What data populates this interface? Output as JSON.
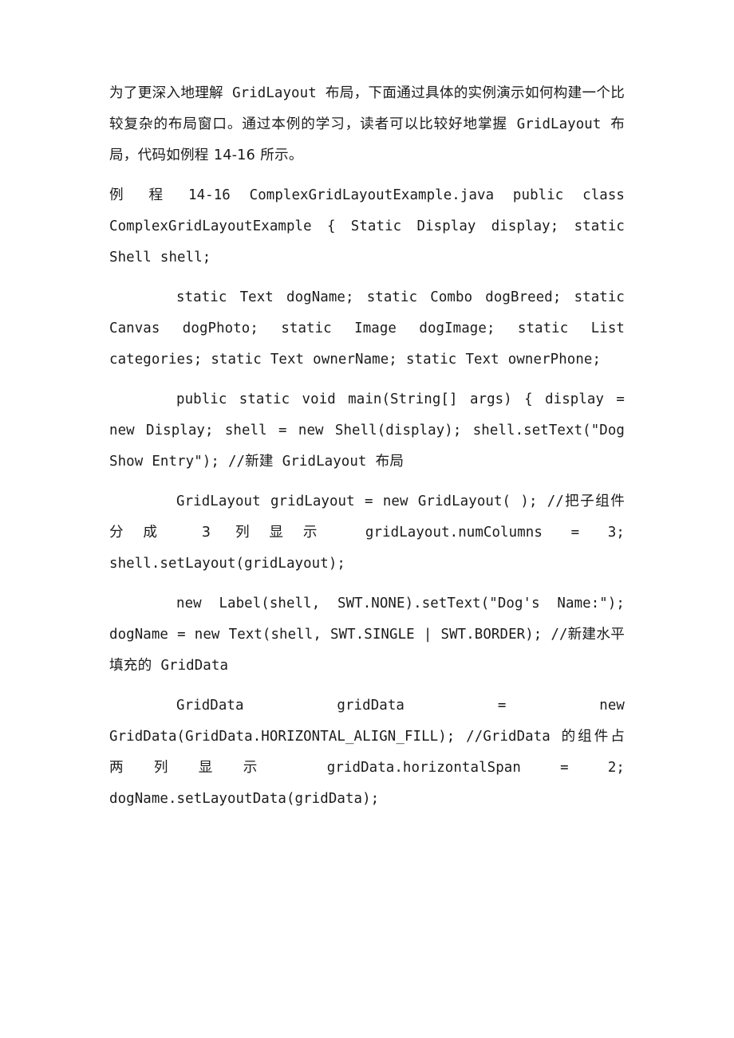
{
  "document": {
    "type": "book-page",
    "language": "zh-CN",
    "page_background": "#ffffff",
    "text_color": "#1b1b1b",
    "body": {
      "intro_paragraph": "为了更深入地理解 GridLayout 布局，下面通过具体的实例演示如何构建一个比较复杂的布局窗口。通过本例的学习，读者可以比较好地掌握 GridLayout 布局，代码如例程 14-16 所示。",
      "listing_heading": "例 程 14-16    ComplexGridLayoutExample.java  public class ComplexGridLayoutExample {            Static Display display;  static Shell shell;",
      "listing_fields": "static Text dogName;          static Combo dogBreed;  static Canvas dogPhoto;          static Image dogImage;  static List categories;          static Text ownerName;  static Text ownerPhone;",
      "listing_main": "public static void main(String[] args) {  display = new Display;          shell = new Shell(display);  shell.setText(\"Dog Show Entry\");            //新建 GridLayout 布局",
      "listing_gridlayout": "GridLayout gridLayout = new GridLayout( );  //把子组件分成 3 列显示          gridLayout.numColumns = 3;  shell.setLayout(gridLayout);",
      "listing_label": "new Label(shell, SWT.NONE).setText(\"Dog's Name:\");  dogName = new Text(shell, SWT.SINGLE | SWT.BORDER);  //新建水平填充的 GridData",
      "listing_griddata": "GridData gridData = new GridData(GridData.HORIZONTAL_ALIGN_FILL);  //GridData 的组件占两列显示          gridData.horizontalSpan = 2;          dogName.setLayoutData(gridData);"
    },
    "fragments": {
      "p1": [
        {
          "t": "cjk",
          "s": "为了更深入地理解"
        },
        {
          "t": "code",
          "s": " GridLayout "
        },
        {
          "t": "cjk",
          "s": "布局，下面通过具体的实例演示如何构建一个比较复杂的布局窗口。通过本例的学习，读者可以比较好地掌握"
        },
        {
          "t": "code",
          "s": " GridLayout "
        },
        {
          "t": "cjk",
          "s": "布局，代码如例程 14-16 所示。"
        }
      ],
      "p2": [
        {
          "t": "cjk",
          "s": "例 程 "
        },
        {
          "t": "code",
          "s": "14-16    ComplexGridLayoutExample.java  public  class  ComplexGridLayoutExample {            Static  Display  display;  static Shell shell;"
        }
      ],
      "p3": [
        {
          "t": "code",
          "s": "static  Text  dogName;          static  Combo  dogBreed;  static  Canvas  dogPhoto;          static  Image  dogImage;  static  List  categories;          static  Text  ownerName;  static Text ownerPhone;"
        }
      ],
      "p4": [
        {
          "t": "code",
          "s": "public    static    void    main(String[]    args)    {  display = new Display;          shell = new Shell(display);  shell.setText(\"Dog Show Entry\");            //"
        },
        {
          "t": "cjk",
          "s": "新建"
        },
        {
          "t": "code",
          "s": " GridLayout "
        },
        {
          "t": "cjk",
          "s": "布局"
        }
      ],
      "p5": [
        {
          "t": "code",
          "s": "GridLayout   gridLayout   =   new   GridLayout( );  //"
        },
        {
          "t": "cjk",
          "s": "把子组件分成 3 列显示"
        },
        {
          "t": "code",
          "s": "          gridLayout.numColumns = 3;  shell.setLayout(gridLayout);"
        }
      ],
      "p6": [
        {
          "t": "code",
          "s": "new  Label(shell,  SWT.NONE).setText(\"Dog's  Name:\");  dogName  =  new  Text(shell,  SWT.SINGLE  |  SWT.BORDER);  //"
        },
        {
          "t": "cjk",
          "s": "新建水平填充的"
        },
        {
          "t": "code",
          "s": " GridData"
        }
      ],
      "p7": [
        {
          "t": "code",
          "s": "GridData        gridData        =        new  GridData(GridData.HORIZONTAL_ALIGN_FILL);  //"
        },
        {
          "t": "code",
          "s": "GridData "
        },
        {
          "t": "cjk",
          "s": "的组件占两列显示"
        },
        {
          "t": "code",
          "s": "          gridData.horizontalSpan = 2;          dogName.setLayoutData(gridData);"
        }
      ]
    }
  }
}
